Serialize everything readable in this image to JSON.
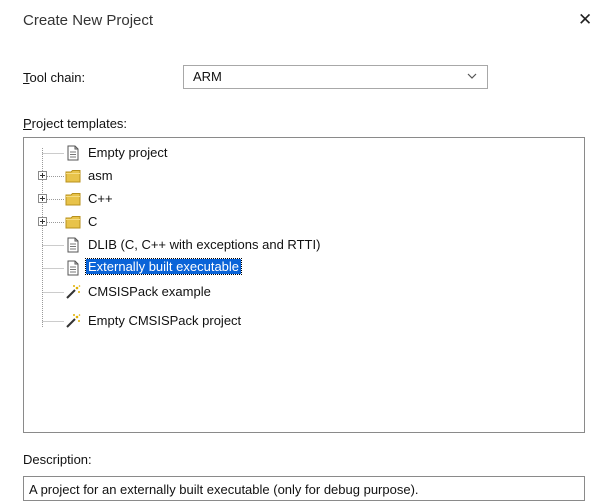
{
  "dialog": {
    "title": "Create New Project",
    "close_glyph": "✕"
  },
  "toolchain": {
    "label_u": "T",
    "label_rest": "ool chain:",
    "value": "ARM"
  },
  "templates": {
    "label_u": "P",
    "label_rest": "roject templates:",
    "items": [
      {
        "label": "Empty project",
        "icon": "document-icon",
        "expandable": false,
        "selected": false
      },
      {
        "label": "asm",
        "icon": "folder-icon",
        "expandable": true,
        "selected": false
      },
      {
        "label": "C++",
        "icon": "folder-icon",
        "expandable": true,
        "selected": false
      },
      {
        "label": "C",
        "icon": "folder-icon",
        "expandable": true,
        "selected": false
      },
      {
        "label": "DLIB (C, C++ with exceptions and RTTI)",
        "icon": "document-icon",
        "expandable": false,
        "selected": false
      },
      {
        "label": "Externally built executable",
        "icon": "document-icon",
        "expandable": false,
        "selected": true
      },
      {
        "label": "CMSISPack example",
        "icon": "wand-icon",
        "expandable": false,
        "selected": false
      },
      {
        "label": "Empty CMSISPack project",
        "icon": "wand-icon",
        "expandable": false,
        "selected": false
      }
    ]
  },
  "description": {
    "label": "Description:",
    "text": "A project for an externally built executable (only for debug purpose)."
  }
}
